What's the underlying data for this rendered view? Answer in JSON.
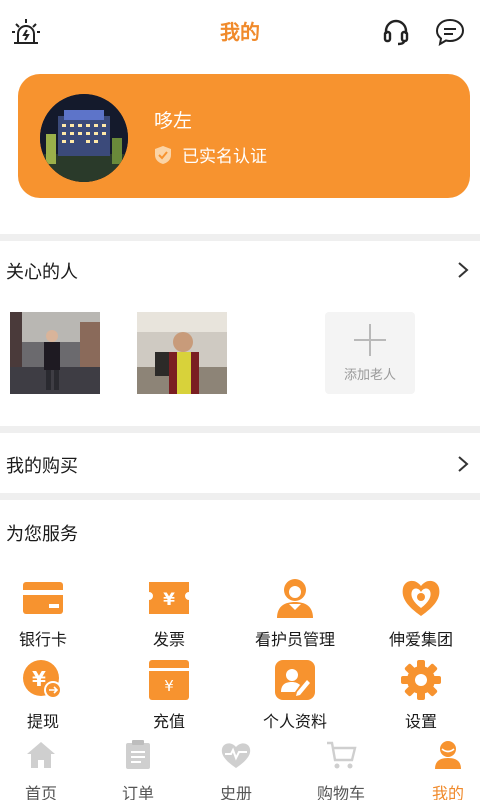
{
  "header": {
    "title": "我的"
  },
  "profile": {
    "name": "哆左",
    "verified_text": "已实名认证"
  },
  "care": {
    "title": "关心的人",
    "add_label": "添加老人"
  },
  "purchases": {
    "title": "我的购买"
  },
  "services": {
    "title": "为您服务",
    "items": [
      {
        "label": "银行卡",
        "icon": "bank-card-icon"
      },
      {
        "label": "发票",
        "icon": "invoice-icon"
      },
      {
        "label": "看护员管理",
        "icon": "caregiver-icon"
      },
      {
        "label": "伸爱集团",
        "icon": "group-logo-icon"
      },
      {
        "label": "提现",
        "icon": "withdraw-icon"
      },
      {
        "label": "充值",
        "icon": "recharge-icon"
      },
      {
        "label": "个人资料",
        "icon": "profile-edit-icon"
      },
      {
        "label": "设置",
        "icon": "settings-gear-icon"
      }
    ]
  },
  "tabs": [
    {
      "label": "首页",
      "icon": "home-icon"
    },
    {
      "label": "订单",
      "icon": "order-icon"
    },
    {
      "label": "史册",
      "icon": "heart-history-icon"
    },
    {
      "label": "购物车",
      "icon": "cart-icon"
    },
    {
      "label": "我的",
      "icon": "user-icon",
      "active": true
    }
  ],
  "colors": {
    "accent": "#f7932f",
    "text_accent": "#f08a2b",
    "divider": "#efefef"
  }
}
